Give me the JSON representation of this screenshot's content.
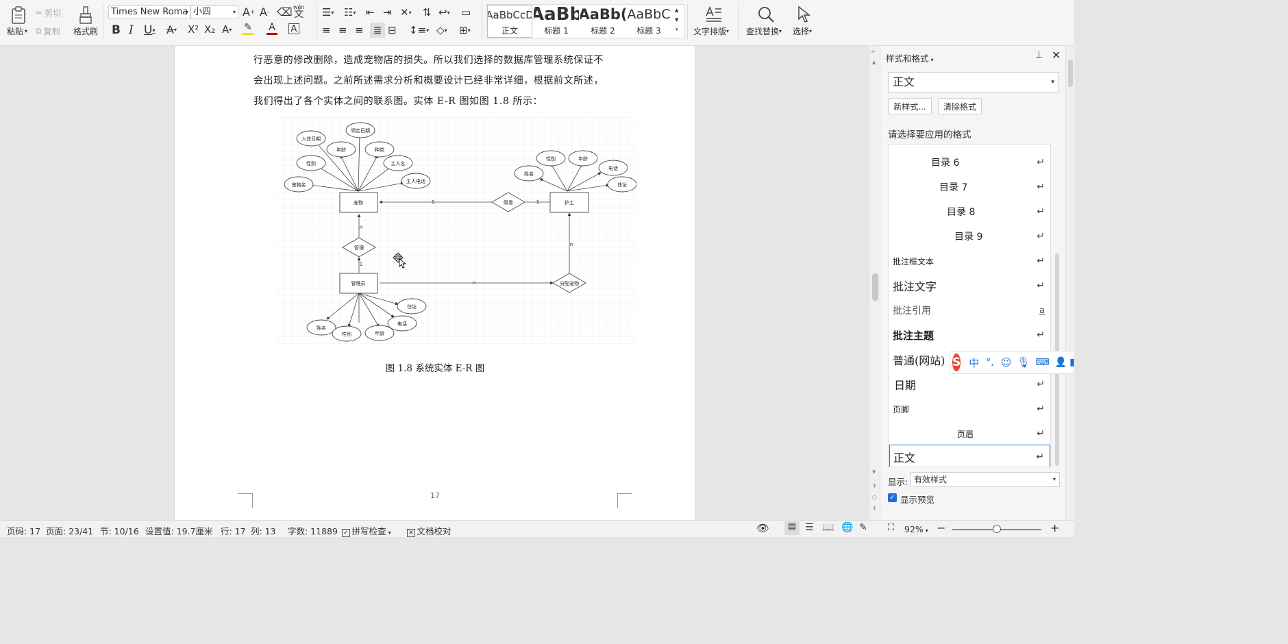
{
  "ribbon": {
    "paste": "粘贴",
    "cut": "剪切",
    "copy": "复制",
    "format_painter": "格式刷",
    "font_name": "Times New Roma",
    "font_size": "小四",
    "styles": [
      {
        "preview": "AaBbCcD",
        "name": "正文"
      },
      {
        "preview": "AaBb",
        "name": "标题 1"
      },
      {
        "preview": "AaBb(",
        "name": "标题 2"
      },
      {
        "preview": "AaBbC",
        "name": "标题 3"
      }
    ],
    "text_layout": "文字排版",
    "find_replace": "查找替换",
    "select": "选择",
    "wen_glyph": "wén",
    "wen_char": "文"
  },
  "document": {
    "lines": [
      "行恶意的修改删除，造成宠物店的损失。所以我们选择的数据库管理系统保证不",
      "会出现上述问题。之前所述需求分析和概要设计已经非常详细，根据前文所述，",
      "我们得出了各个实体之间的联系图。实体 E-R 图如图 1.8 所示："
    ],
    "caption": "图 1.8 系统实体 E-R 图",
    "page_number": "17"
  },
  "er": {
    "entities": {
      "pet": "宠物",
      "nurse": "护工",
      "admin": "管理员"
    },
    "relations": {
      "care": "照看",
      "manage": "管理",
      "assign": "分配宠物"
    },
    "pet_attrs": [
      "入住日期",
      "领走日期",
      "年龄",
      "种类",
      "性别",
      "主人名",
      "宠物名",
      "主人电话"
    ],
    "nurse_attrs": [
      "性别",
      "年龄",
      "姓名",
      "电话",
      "住址"
    ],
    "admin_attrs": [
      "住址",
      "电话",
      "姓名",
      "性别",
      "年龄"
    ],
    "card": {
      "one": "1",
      "many": "n"
    }
  },
  "panel": {
    "title": "样式和格式",
    "current_style": "正文",
    "new_style": "新样式...",
    "clear_format": "清除格式",
    "choose_label": "请选择要应用的格式",
    "items": [
      {
        "label": "目录 6"
      },
      {
        "label": "目录 7"
      },
      {
        "label": "目录 8"
      },
      {
        "label": "目录 9"
      },
      {
        "label": "批注框文本"
      },
      {
        "label": "批注文字"
      },
      {
        "label": "批注引用"
      },
      {
        "label": "批注主题"
      },
      {
        "label": "普通(网站)"
      },
      {
        "label": "日期"
      },
      {
        "label": "页脚"
      },
      {
        "label": "页眉"
      },
      {
        "label": "正文"
      }
    ],
    "show_label": "显示:",
    "show_value": "有效样式",
    "show_preview": "显示预览",
    "return_glyph": "↵",
    "char_glyph": "a"
  },
  "ime": {
    "zh": "中",
    "punct": "°,"
  },
  "status": {
    "page_code": "页码: 17",
    "page": "页面: 23/41",
    "section": "节: 10/16",
    "setting": "设置值: 19.7厘米",
    "row": "行: 17",
    "col": "列: 13",
    "word_count": "字数: 11889",
    "spell_check": "拼写检查",
    "doc_proof": "文档校对",
    "zoom": "92%"
  },
  "colors": {
    "accent": "#1e6fd9",
    "highlight": "#f5e000",
    "font_color": "#c00000",
    "ime": "#e8452c"
  }
}
